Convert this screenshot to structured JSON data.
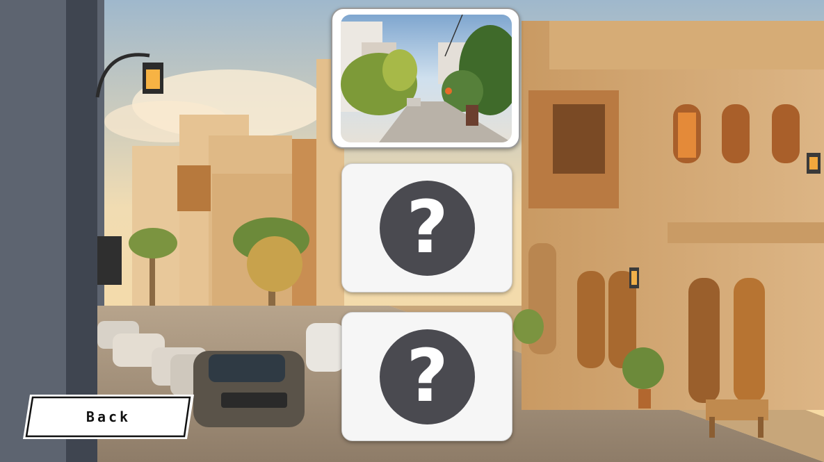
{
  "screen": {
    "name": "level-select"
  },
  "levels": [
    {
      "id": "1",
      "state": "unlocked",
      "thumbnail": "street-photo"
    },
    {
      "id": "2",
      "state": "locked",
      "badge": "?"
    },
    {
      "id": "3",
      "state": "locked",
      "badge": "?"
    }
  ],
  "back_button": {
    "label": "Back"
  },
  "colors": {
    "badge": "#4a4a50",
    "card": "#f6f6f6",
    "sky": "#f3d9a8",
    "wall": "#d9b27e"
  }
}
